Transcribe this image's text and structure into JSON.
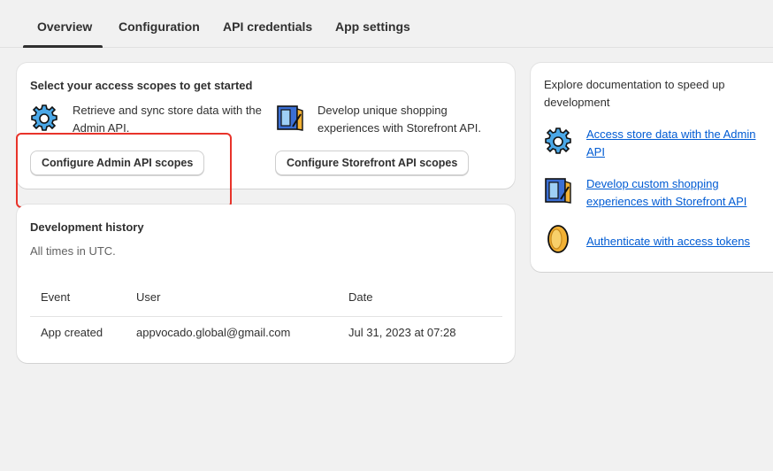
{
  "tabs": [
    {
      "label": "Overview",
      "active": true
    },
    {
      "label": "Configuration",
      "active": false
    },
    {
      "label": "API credentials",
      "active": false
    },
    {
      "label": "App settings",
      "active": false
    }
  ],
  "access_scopes": {
    "title": "Select your access scopes to get started",
    "admin": {
      "description": "Retrieve and sync store data with the Admin API.",
      "button_label": "Configure Admin API scopes",
      "icon": "gear-icon"
    },
    "storefront": {
      "description": "Develop unique shopping experiences with Storefront API.",
      "button_label": "Configure Storefront API scopes",
      "icon": "storefront-icon"
    }
  },
  "history": {
    "title": "Development history",
    "subtitle": "All times in UTC.",
    "columns": [
      "Event",
      "User",
      "Date"
    ],
    "rows": [
      {
        "event": "App created",
        "user": "appvocado.global@gmail.com",
        "date": "Jul 31, 2023 at 07:28"
      }
    ]
  },
  "docs": {
    "intro": "Explore documentation to speed up development",
    "links": [
      {
        "label": "Access store data with the Admin API",
        "icon": "gear-icon"
      },
      {
        "label": "Develop custom shopping experiences with Storefront API",
        "icon": "storefront-icon"
      },
      {
        "label": "Authenticate with access tokens",
        "icon": "token-coin-icon"
      }
    ]
  },
  "colors": {
    "link": "#005bd3",
    "highlight_box": "#e8332a",
    "background": "#f1f1f1"
  }
}
